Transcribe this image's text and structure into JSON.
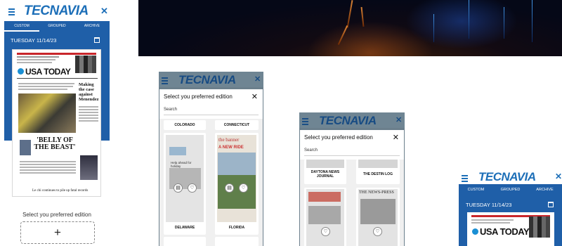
{
  "app": {
    "brand": "TECNAVIA",
    "tabs": [
      "CUSTOM",
      "GROUPED",
      "ARCHIVE"
    ],
    "date": "TUESDAY 11/14/23",
    "select_prompt": "Select you preferred edition",
    "add_symbol": "+"
  },
  "newspaper": {
    "masthead": "USA TODAY",
    "headline_right": "Making the case against Menendez",
    "headline_mid": "'BELLY OF THE BEAST'",
    "footer_line": "Le chi continues to pile up fatal records"
  },
  "modal": {
    "title": "Select you preferred edition",
    "close": "✕",
    "search_label": "Search"
  },
  "panel3": {
    "cards": [
      {
        "label": "COLORADO"
      },
      {
        "label": "CONNECTICUT"
      },
      {
        "label": "DELAWARE",
        "headline": "Help ahead for holiday"
      },
      {
        "label": "FLORIDA",
        "masthead": "the banner",
        "headline": "A NEW RIDE"
      }
    ]
  },
  "panel4": {
    "cards": [
      {
        "label": "DAYTONA NEWS JOURNAL"
      },
      {
        "label": "THE DESTIN LOG"
      },
      {
        "label": "",
        "masthead": "THE NEWS-PRESS"
      }
    ]
  },
  "icons": {
    "menu": "hamburger-icon",
    "close": "close-icon",
    "calendar": "calendar-icon",
    "read": "book-icon",
    "favorite": "heart-icon"
  },
  "colors": {
    "brand_blue": "#1d6fb8",
    "bar_blue": "#1f5fa8",
    "overlay": "#6b7f8c"
  }
}
